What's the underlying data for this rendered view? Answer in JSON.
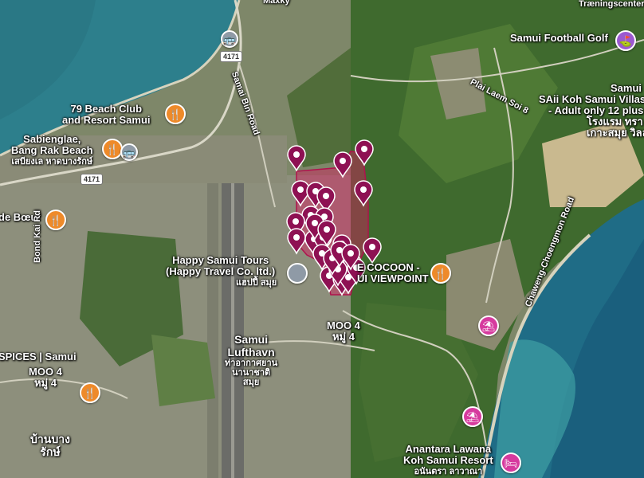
{
  "map": {
    "labels": {
      "maxky": "Maxky",
      "samui_football_golf": "Samui Football Golf",
      "traeningscenter": "Træningscenter",
      "plai_laem_soi_8": "Plai Laem Soi 8",
      "samui_villas_1": "Samui",
      "samui_villas_2": "SAii Koh Samui Villas",
      "samui_villas_3": "- Adult only 12 plus",
      "samui_villas_4": "โรงแรม ทรา",
      "samui_villas_5": "เกาะสมุย วิลล่า",
      "beach_club_1": "79 Beach Club",
      "beach_club_2": "and Resort Samui",
      "sabienglae_1": "Sabienglae,",
      "sabienglae_2": "Bang Rak Beach",
      "sabienglae_3": "เสบียงเล หาดบางรักษ์",
      "de_boeuf": "de Bœuf",
      "bond_kai_rd": "Bond Kai Rd",
      "samai_bin_road": "Samai Bin Road",
      "chaweng_road": "Chaweng-Choengmon Road",
      "happy_samui_1": "Happy Samui Tours",
      "happy_samui_2": "(Happy Travel Co. ltd.)",
      "happy_samui_3": "แฮปปี้ สมุย",
      "cocoon_1": "E COCOON -",
      "cocoon_2": "UI VIEWPOINT",
      "moo4_center_1": "MOO 4",
      "moo4_center_2": "หมู่ 4",
      "samui_airport_1": "Samui",
      "samui_airport_2": "Lufthavn",
      "samui_airport_3": "ท่าอากาศยาน",
      "samui_airport_4": "นานาชาติ",
      "samui_airport_5": "สมุย",
      "spices": "SPICES | Samui",
      "moo4_left_1": "MOO 4",
      "moo4_left_2": "หมู่ 4",
      "ban_nam_1": "บ้านบาง",
      "ban_nam_2": "รักษ์",
      "anantara_1": "Anantara Lawana",
      "anantara_2": "Koh Samui Resort",
      "anantara_3": "อนันตรา ลาวาณา"
    },
    "road_shields": {
      "r4171_top": "4171",
      "r4171_left": "4171"
    },
    "pois": [
      {
        "name": "restaurant-icon",
        "glyph": "🍴",
        "color": "#ee8a2a"
      },
      {
        "name": "restaurant-icon",
        "glyph": "🍴",
        "color": "#ee8a2a"
      },
      {
        "name": "restaurant-icon",
        "glyph": "🍴",
        "color": "#ee8a2a"
      },
      {
        "name": "restaurant-icon",
        "glyph": "🍴",
        "color": "#ee8a2a"
      },
      {
        "name": "restaurant-icon",
        "glyph": "🍴",
        "color": "#ee8a2a"
      },
      {
        "name": "beach-umbrella-icon",
        "glyph": "⛱",
        "color": "#d63a9e"
      },
      {
        "name": "beach-umbrella-icon",
        "glyph": "⛱",
        "color": "#d63a9e"
      },
      {
        "name": "hotel-icon",
        "glyph": "🛏",
        "color": "#d63a9e"
      },
      {
        "name": "golf-icon",
        "glyph": "⛳",
        "color": "#9b59d0"
      },
      {
        "name": "hotel-icon",
        "glyph": "🛏",
        "color": "#d63a9e"
      }
    ],
    "colors": {
      "pin": "#8e1153",
      "region": "#d81b60",
      "water": "#2a7e8a",
      "land": "#7d8669"
    },
    "pin_count": 29
  }
}
